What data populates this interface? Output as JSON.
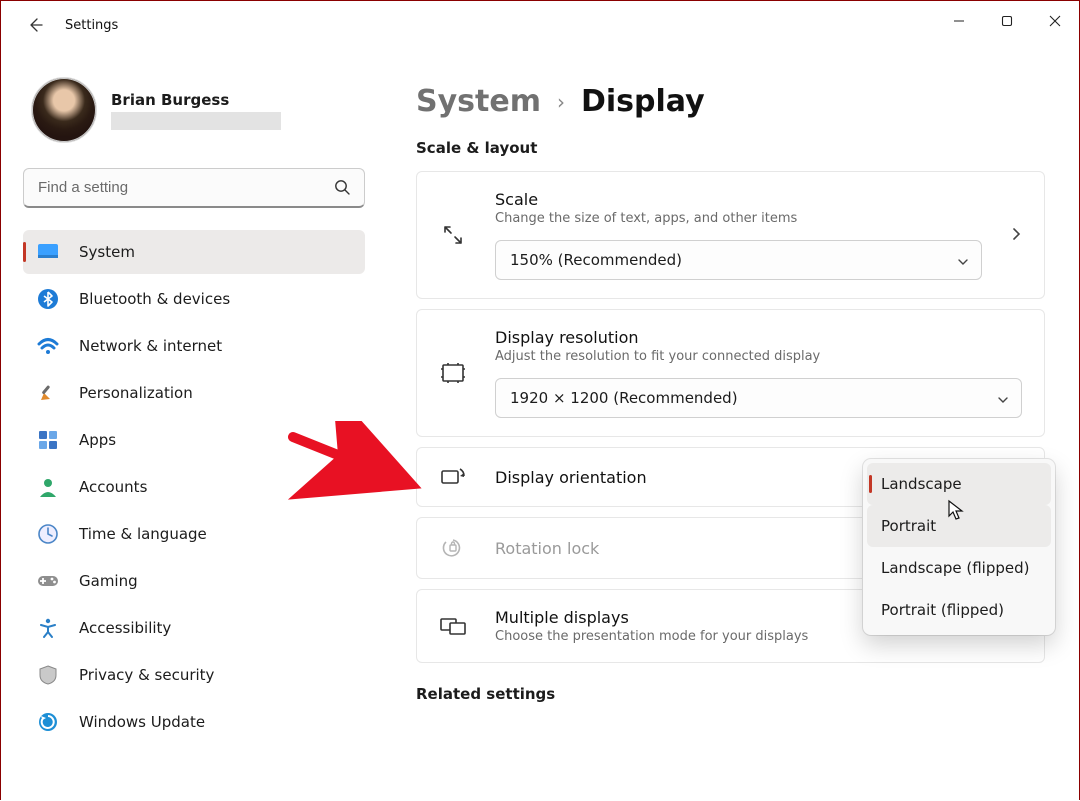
{
  "window": {
    "title": "Settings"
  },
  "user": {
    "name": "Brian Burgess"
  },
  "search": {
    "placeholder": "Find a setting"
  },
  "nav": {
    "items": [
      {
        "label": "System"
      },
      {
        "label": "Bluetooth & devices"
      },
      {
        "label": "Network & internet"
      },
      {
        "label": "Personalization"
      },
      {
        "label": "Apps"
      },
      {
        "label": "Accounts"
      },
      {
        "label": "Time & language"
      },
      {
        "label": "Gaming"
      },
      {
        "label": "Accessibility"
      },
      {
        "label": "Privacy & security"
      },
      {
        "label": "Windows Update"
      }
    ],
    "selected": 0
  },
  "breadcrumb": {
    "root": "System",
    "current": "Display"
  },
  "sections": {
    "scale_layout": "Scale & layout",
    "related": "Related settings"
  },
  "scale": {
    "title": "Scale",
    "sub": "Change the size of text, apps, and other items",
    "value": "150% (Recommended)"
  },
  "resolution": {
    "title": "Display resolution",
    "sub": "Adjust the resolution to fit your connected display",
    "value": "1920 × 1200 (Recommended)"
  },
  "orientation": {
    "title": "Display orientation",
    "options": [
      {
        "label": "Landscape"
      },
      {
        "label": "Portrait"
      },
      {
        "label": "Landscape (flipped)"
      },
      {
        "label": "Portrait (flipped)"
      }
    ],
    "selected": 0,
    "hover": 1
  },
  "rotation_lock": {
    "title": "Rotation lock"
  },
  "multiple": {
    "title": "Multiple displays",
    "sub": "Choose the presentation mode for your displays"
  }
}
